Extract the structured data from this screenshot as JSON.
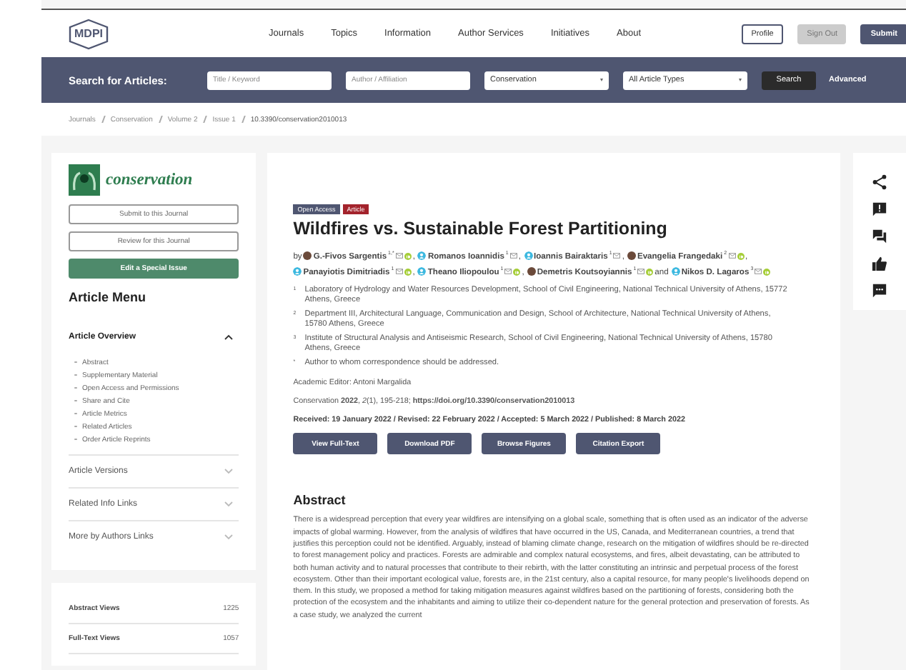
{
  "header": {
    "logo": "MDPI",
    "nav": [
      "Journals",
      "Topics",
      "Information",
      "Author Services",
      "Initiatives",
      "About"
    ],
    "buttons": [
      {
        "label": "Profile",
        "kind": "outline"
      },
      {
        "label": "Sign Out",
        "kind": "disabled"
      },
      {
        "label": "Submit",
        "kind": "solid"
      }
    ]
  },
  "search": {
    "label": "Search for Articles:",
    "fields": [
      {
        "placeholder": "Title / Keyword"
      },
      {
        "placeholder": "Author / Affiliation"
      }
    ],
    "selects": [
      "Conservation",
      "All Article Types"
    ],
    "button": "Search",
    "advanced": "Advanced"
  },
  "breadcrumb": [
    "Journals",
    "Conservation",
    "Volume 2",
    "Issue 1",
    "10.3390/conservation2010013"
  ],
  "sidebar": {
    "journal": "conservation",
    "buttons": [
      {
        "label": "Submit to this Journal",
        "kind": "outline"
      },
      {
        "label": "Review for this Journal",
        "kind": "outline"
      },
      {
        "label": "Edit a Special Issue",
        "kind": "solid"
      }
    ],
    "menu_title": "Article Menu",
    "sections": [
      {
        "label": "Article Overview",
        "expanded": true,
        "items": [
          "Abstract",
          "Supplementary Material",
          "Open Access and Permissions",
          "Share and Cite",
          "Article Metrics",
          "Related Articles",
          "Order Article Reprints"
        ]
      },
      {
        "label": "Article Versions",
        "expanded": false
      },
      {
        "label": "Related Info Links",
        "expanded": false
      },
      {
        "label": "More by Authors Links",
        "expanded": false
      }
    ],
    "stats": [
      {
        "label": "Abstract Views",
        "value": "1225"
      },
      {
        "label": "Full-Text Views",
        "value": "1057"
      }
    ]
  },
  "article": {
    "badges": [
      {
        "label": "Open Access",
        "color": "#4f5671"
      },
      {
        "label": "Article",
        "color": "#a3232c"
      }
    ],
    "title": "Wildfires vs. Sustainable Forest Partitioning",
    "by": "by",
    "authors": [
      {
        "name": "G.-Fivos Sargentis",
        "sup": "1,*",
        "kind": "photo",
        "orcid": true,
        "sep": ","
      },
      {
        "name": "Romanos Ioannidis",
        "sup": "1",
        "kind": "avatar",
        "orcid": false,
        "sep": ","
      },
      {
        "name": "Ioannis Bairaktaris",
        "sup": "1",
        "kind": "avatar",
        "orcid": false,
        "sep": ","
      },
      {
        "name": "Evangelia Frangedaki",
        "sup": "2",
        "kind": "photo",
        "orcid": true,
        "sep": ","
      },
      {
        "name": "Panayiotis Dimitriadis",
        "sup": "1",
        "kind": "avatar",
        "orcid": true,
        "sep": ","
      },
      {
        "name": "Theano Iliopoulou",
        "sup": "1",
        "kind": "avatar",
        "orcid": true,
        "sep": ","
      },
      {
        "name": "Demetris Koutsoyiannis",
        "sup": "1",
        "kind": "photo",
        "orcid": true,
        "sep": "and"
      },
      {
        "name": "Nikos D. Lagaros",
        "sup": "3",
        "kind": "avatar",
        "orcid": true
      }
    ],
    "affiliations": [
      {
        "mark": "1",
        "text": "Laboratory of Hydrology and Water Resources Development, School of Civil Engineering, National Technical University of Athens, 15772 Athens, Greece"
      },
      {
        "mark": "2",
        "text": "Department III, Architectural Language, Communication and Design, School of Architecture, National Technical University of Athens, 15780 Athens, Greece"
      },
      {
        "mark": "3",
        "text": "Institute of Structural Analysis and Antiseismic Research, School of Civil Engineering, National Technical University of Athens, 15780 Athens, Greece"
      },
      {
        "mark": "*",
        "text": "Author to whom correspondence should be addressed."
      }
    ],
    "editor": "Academic Editor: Antoni Margalida",
    "citation": "Conservation **2022**, *2*(1), 195-218; **https://doi.org/10.3390/conservation2010013**",
    "dates": "Received: 19 January 2022 / Revised: 22 February 2022 / Accepted: 5 March 2022 / Published: 8 March 2022",
    "actions": [
      "View Full-Text",
      "Download PDF",
      "Browse Figures",
      "Citation Export"
    ],
    "abstract_title": "Abstract",
    "abstract": "There is a widespread perception that every year wildfires are intensifying on a global scale, something that is often used as an indicator of the adverse impacts of global warming. However, from the analysis of wildfires that have occurred in the US, Canada, and Mediterranean countries, a trend that justifies this perception could not be identified. Arguably, instead of blaming climate change, research on the mitigation of wildfires should be re-directed to forest management policy and practices. Forests are admirable and complex natural ecosystems, and fires, albeit devastating, can be attributed to both human activity and to natural processes that contribute to their rebirth, with the latter constituting an intrinsic and perpetual process of the forest ecosystem. Other than their important ecological value, forests are, in the 21st century, also a capital resource, for many people's livelihoods depend on them. In this study, we proposed a method for taking mitigation measures against wildfires based on the partitioning of forests, considering both the protection of the ecosystem and the inhabitants and aiming to utilize their co-dependent nature for the general protection and preservation of forests. As a case study, we analyzed the current"
  },
  "side_tools": [
    {
      "kind": "share"
    },
    {
      "kind": "flag"
    },
    {
      "kind": "comments"
    },
    {
      "kind": "like"
    },
    {
      "kind": "chat"
    }
  ]
}
